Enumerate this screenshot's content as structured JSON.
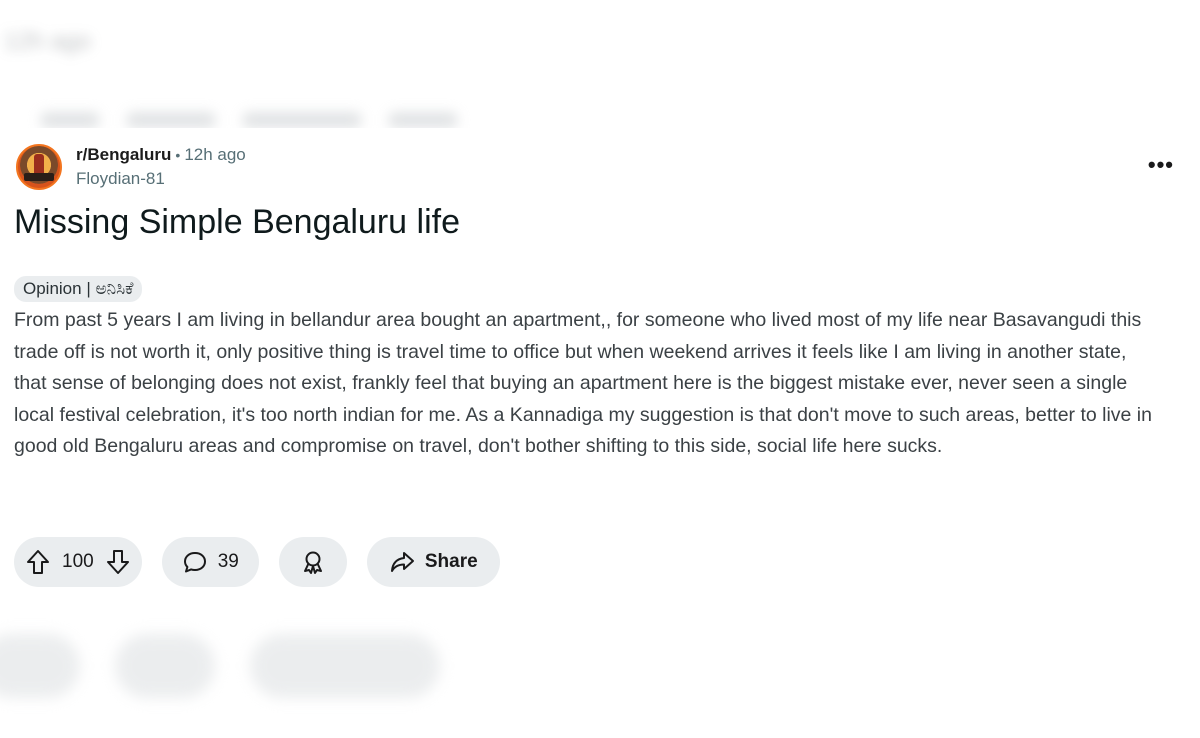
{
  "background": {
    "top_ghost_text": "12h ago"
  },
  "post": {
    "subreddit": "r/Bengaluru",
    "separator": "•",
    "time": "12h ago",
    "author": "Floydian-81",
    "more_label": "•••",
    "title": "Missing Simple Bengaluru life",
    "flair": "Opinion | ಅನಿಸಿಕೆ",
    "body": "From past 5 years I am living in bellandur area bought an apartment,, for someone who lived most of my life near Basavangudi this trade off is not worth it, only positive thing is travel time to office but when weekend arrives it feels like I am living in another state, that sense of belonging does not exist, frankly feel that buying an apartment here is the biggest mistake ever, never seen a single local festival celebration, it's too north indian for me. As a Kannadiga my suggestion is that don't move to such areas, better to live in good old Bengaluru areas and compromise on travel, don't bother shifting to this side, social life here sucks."
  },
  "actions": {
    "score": "100",
    "comments": "39",
    "share_label": "Share"
  },
  "icons": {
    "avatar": "subreddit-avatar",
    "more": "more-options-icon",
    "upvote": "upvote-arrow-icon",
    "downvote": "downvote-arrow-icon",
    "comment": "speech-bubble-icon",
    "award": "award-ribbon-icon",
    "share": "share-arrow-icon"
  },
  "colors": {
    "pill_bg": "#eaedef",
    "meta_gray": "#576f76",
    "title": "#0f1a1c",
    "body_text": "#3b4145"
  }
}
